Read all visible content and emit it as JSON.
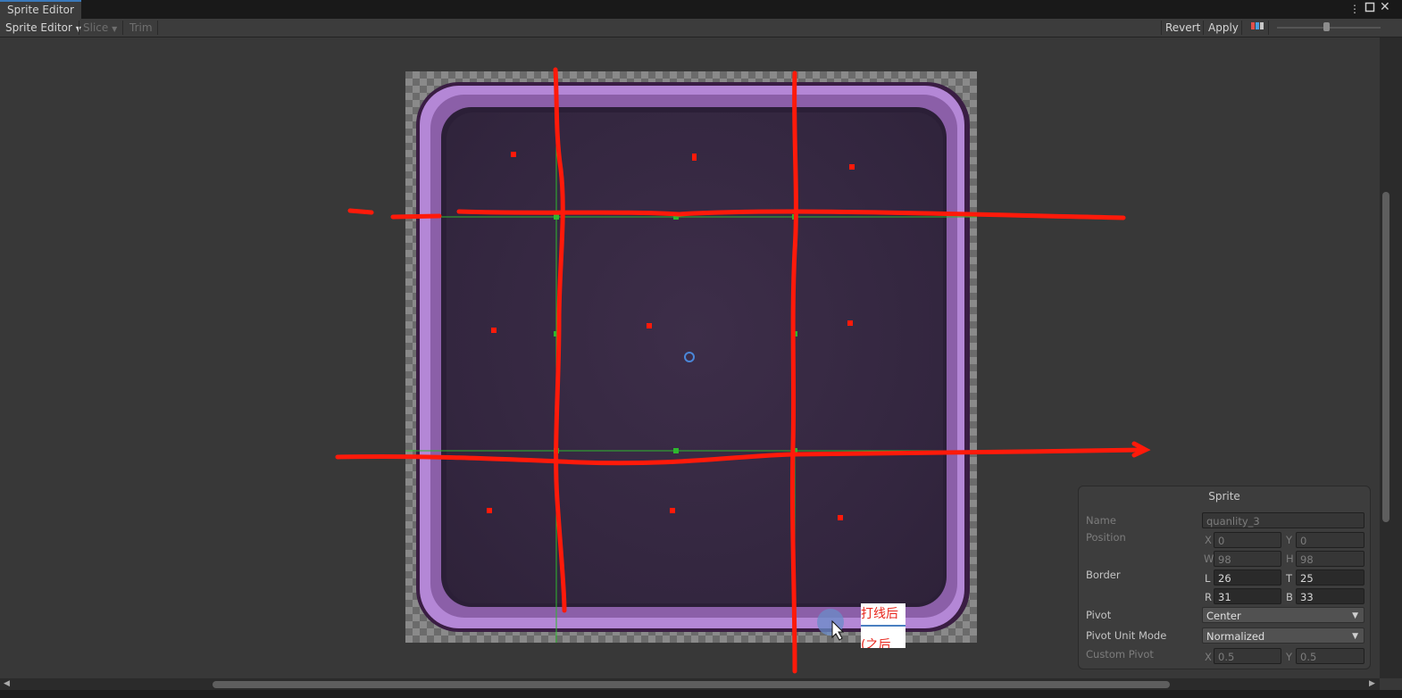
{
  "window": {
    "tab_title": "Sprite Editor",
    "menu_icon": "kebab-icon",
    "maximize_icon": "maximize-icon",
    "close_icon": "close-icon"
  },
  "toolbar": {
    "mode_label": "Sprite Editor",
    "slice_label": "Slice",
    "trim_label": "Trim",
    "revert_label": "Revert",
    "apply_label": "Apply",
    "dropdown_icon": "chevron-down-icon",
    "color_channel_icon": "rgb-channel-icon"
  },
  "sprite_panel": {
    "title": "Sprite",
    "name_label": "Name",
    "name_value": "quanlity_3",
    "position_label": "Position",
    "pos_x_label": "X",
    "pos_x_value": "0",
    "pos_y_label": "Y",
    "pos_y_value": "0",
    "pos_w_label": "W",
    "pos_w_value": "98",
    "pos_h_label": "H",
    "pos_h_value": "98",
    "border_label": "Border",
    "border_l_label": "L",
    "border_l_value": "26",
    "border_t_label": "T",
    "border_t_value": "25",
    "border_r_label": "R",
    "border_r_value": "31",
    "border_b_label": "B",
    "border_b_value": "33",
    "pivot_label": "Pivot",
    "pivot_value": "Center",
    "pivot_unit_mode_label": "Pivot Unit Mode",
    "pivot_unit_mode_value": "Normalized",
    "custom_pivot_label": "Custom Pivot",
    "custom_x_label": "X",
    "custom_x_value": "0.5",
    "custom_y_label": "Y",
    "custom_y_value": "0.5"
  },
  "annotation": {
    "text_line1": "打线后",
    "text_line2": "(之后"
  },
  "colors": {
    "accent": "#3a79bb",
    "annotation_red": "#ff1a0a",
    "border_guide_green": "#2eb82e",
    "frame_purple": "#b487d6"
  }
}
